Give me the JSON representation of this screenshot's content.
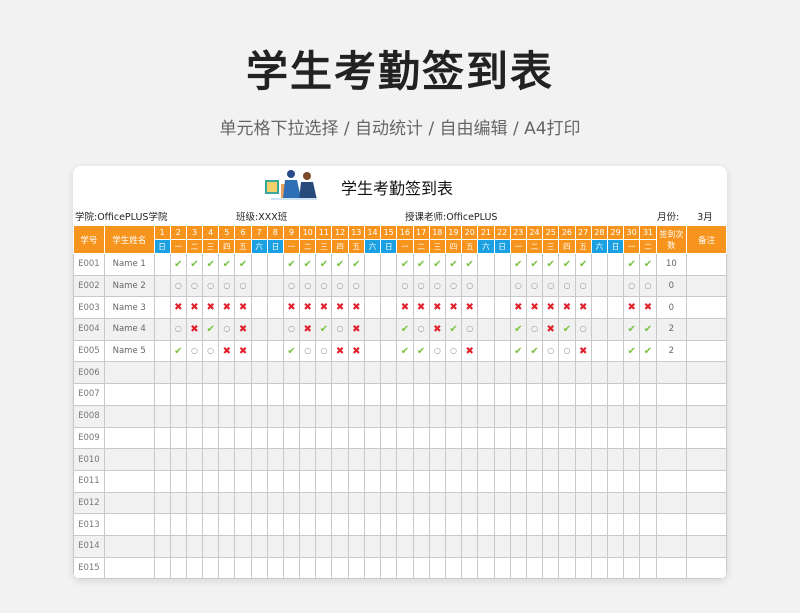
{
  "page": {
    "title": "学生考勤签到表",
    "subtitle": "单元格下拉选择 / 自动统计 / 自由编辑 / A4打印"
  },
  "sheet": {
    "title": "学生考勤签到表",
    "school_label": "学院:",
    "school": "OfficePLUS学院",
    "class_label": "班级:",
    "class": "XXX班",
    "teacher_label": "授课老师:",
    "teacher": "OfficePLUS",
    "month_label": "月份:",
    "month": "3月"
  },
  "headers": {
    "id": "学号",
    "name": "学生姓名",
    "count": "签到次数",
    "note": "备注"
  },
  "days": [
    "1",
    "2",
    "3",
    "4",
    "5",
    "6",
    "7",
    "8",
    "9",
    "10",
    "11",
    "12",
    "13",
    "14",
    "15",
    "16",
    "17",
    "18",
    "19",
    "20",
    "21",
    "22",
    "23",
    "24",
    "25",
    "26",
    "27",
    "28",
    "29",
    "30",
    "31"
  ],
  "weekdays": [
    "日",
    "一",
    "二",
    "三",
    "四",
    "五",
    "六",
    "日",
    "一",
    "二",
    "三",
    "四",
    "五",
    "六",
    "日",
    "一",
    "二",
    "三",
    "四",
    "五",
    "六",
    "日",
    "一",
    "二",
    "三",
    "四",
    "五",
    "六",
    "日",
    "一",
    "二"
  ],
  "weekend_color": "#1ba1e2",
  "header_color": "#f7941d",
  "status_colors": {
    "present": "#7cc242",
    "absent": "#e0202a",
    "none": "#999999"
  },
  "students": [
    {
      "id": "E001",
      "name": "Name 1",
      "count": "10",
      "marks": [
        "",
        "✔",
        "✔",
        "✔",
        "✔",
        "✔",
        "",
        "",
        "✔",
        "✔",
        "✔",
        "✔",
        "✔",
        "",
        "",
        "✔",
        "✔",
        "✔",
        "✔",
        "✔",
        "",
        "",
        "✔",
        "✔",
        "✔",
        "✔",
        "✔",
        "",
        "",
        "✔",
        "✔"
      ]
    },
    {
      "id": "E002",
      "name": "Name 2",
      "count": "0",
      "marks": [
        "",
        "○",
        "○",
        "○",
        "○",
        "○",
        "",
        "",
        "○",
        "○",
        "○",
        "○",
        "○",
        "",
        "",
        "○",
        "○",
        "○",
        "○",
        "○",
        "",
        "",
        "○",
        "○",
        "○",
        "○",
        "○",
        "",
        "",
        "○",
        "○"
      ]
    },
    {
      "id": "E003",
      "name": "Name 3",
      "count": "0",
      "marks": [
        "",
        "✖",
        "✖",
        "✖",
        "✖",
        "✖",
        "",
        "",
        "✖",
        "✖",
        "✖",
        "✖",
        "✖",
        "",
        "",
        "✖",
        "✖",
        "✖",
        "✖",
        "✖",
        "",
        "",
        "✖",
        "✖",
        "✖",
        "✖",
        "✖",
        "",
        "",
        "✖",
        "✖"
      ]
    },
    {
      "id": "E004",
      "name": "Name 4",
      "count": "2",
      "marks": [
        "",
        "○",
        "✖",
        "✔",
        "○",
        "✖",
        "",
        "",
        "○",
        "✖",
        "✔",
        "○",
        "✖",
        "",
        "",
        "✔",
        "○",
        "✖",
        "✔",
        "○",
        "",
        "",
        "✔",
        "○",
        "✖",
        "✔",
        "○",
        "",
        "",
        "✔",
        "✔"
      ]
    },
    {
      "id": "E005",
      "name": "Name 5",
      "count": "2",
      "marks": [
        "",
        "✔",
        "○",
        "○",
        "✖",
        "✖",
        "",
        "",
        "✔",
        "○",
        "○",
        "✖",
        "✖",
        "",
        "",
        "✔",
        "✔",
        "○",
        "○",
        "✖",
        "",
        "",
        "✔",
        "✔",
        "○",
        "○",
        "✖",
        "",
        "",
        "✔",
        "✔"
      ]
    },
    {
      "id": "E006",
      "name": "",
      "count": "",
      "marks": []
    },
    {
      "id": "E007",
      "name": "",
      "count": "",
      "marks": []
    },
    {
      "id": "E008",
      "name": "",
      "count": "",
      "marks": []
    },
    {
      "id": "E009",
      "name": "",
      "count": "",
      "marks": []
    },
    {
      "id": "E010",
      "name": "",
      "count": "",
      "marks": []
    },
    {
      "id": "E011",
      "name": "",
      "count": "",
      "marks": []
    },
    {
      "id": "E012",
      "name": "",
      "count": "",
      "marks": []
    },
    {
      "id": "E013",
      "name": "",
      "count": "",
      "marks": []
    },
    {
      "id": "E014",
      "name": "",
      "count": "",
      "marks": []
    },
    {
      "id": "E015",
      "name": "",
      "count": "",
      "marks": []
    }
  ]
}
